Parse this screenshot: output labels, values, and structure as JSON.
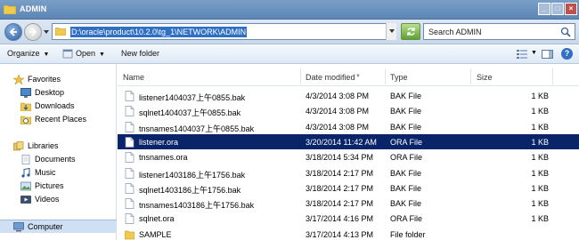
{
  "window": {
    "title": "ADMIN"
  },
  "address": {
    "path": "D:\\oracle\\product\\10.2.0\\tg_1\\NETWORK\\ADMIN"
  },
  "search": {
    "placeholder": "Search ADMIN"
  },
  "toolbar": {
    "organize": "Organize",
    "open": "Open",
    "new_folder": "New folder"
  },
  "nav": {
    "favorites": "Favorites",
    "desktop": "Desktop",
    "downloads": "Downloads",
    "recent": "Recent Places",
    "libraries": "Libraries",
    "documents": "Documents",
    "music": "Music",
    "pictures": "Pictures",
    "videos": "Videos",
    "computer": "Computer"
  },
  "columns": {
    "name": "Name",
    "date": "Date modified",
    "type": "Type",
    "size": "Size"
  },
  "files": [
    {
      "name": "listener1404037上午0855.bak",
      "date": "4/3/2014 3:08 PM",
      "type": "BAK File",
      "size": "1 KB"
    },
    {
      "name": "sqlnet1404037上午0855.bak",
      "date": "4/3/2014 3:08 PM",
      "type": "BAK File",
      "size": "1 KB"
    },
    {
      "name": "tnsnames1404037上午0855.bak",
      "date": "4/3/2014 3:08 PM",
      "type": "BAK File",
      "size": "1 KB"
    },
    {
      "name": "listener.ora",
      "date": "3/20/2014 11:42 AM",
      "type": "ORA File",
      "size": "1 KB"
    },
    {
      "name": "tnsnames.ora",
      "date": "3/18/2014 5:34 PM",
      "type": "ORA File",
      "size": "1 KB"
    },
    {
      "name": "listener1403186上午1756.bak",
      "date": "3/18/2014 2:17 PM",
      "type": "BAK File",
      "size": "1 KB"
    },
    {
      "name": "sqlnet1403186上午1756.bak",
      "date": "3/18/2014 2:17 PM",
      "type": "BAK File",
      "size": "1 KB"
    },
    {
      "name": "tnsnames1403186上午1756.bak",
      "date": "3/18/2014 2:17 PM",
      "type": "BAK File",
      "size": "1 KB"
    },
    {
      "name": "sqlnet.ora",
      "date": "3/17/2014 4:16 PM",
      "type": "ORA File",
      "size": "1 KB"
    },
    {
      "name": "SAMPLE",
      "date": "3/17/2014 4:13 PM",
      "type": "File folder",
      "size": ""
    }
  ],
  "selected_file": "listener.ora",
  "colors": {
    "selection": "#0a246a",
    "titlebar": "#5d86b6",
    "address_highlight": "#3070c4"
  }
}
